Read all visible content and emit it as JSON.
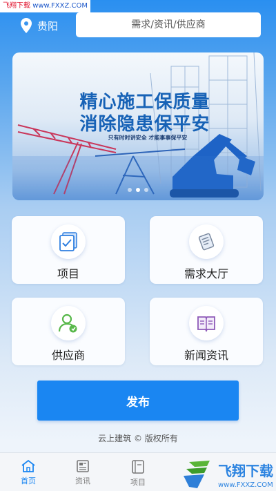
{
  "watermark": {
    "text": "飞翔下载",
    "url": "www.FXXZ.COM"
  },
  "header": {
    "city": "贵阳",
    "search_placeholder": "需求/资讯/供应商"
  },
  "banner": {
    "title_line1": "精心施工保质量",
    "title_line2": "消除隐患保平安",
    "subtitle": "只有时时讲安全 才能事事保平安",
    "dots": 3,
    "active_dot": 2
  },
  "grid": [
    {
      "label": "项目",
      "icon": "project-icon"
    },
    {
      "label": "需求大厅",
      "icon": "demand-hall-icon"
    },
    {
      "label": "供应商",
      "icon": "supplier-icon"
    },
    {
      "label": "新闻资讯",
      "icon": "news-icon"
    }
  ],
  "publish_label": "发布",
  "copyright": "云上建筑 © 版权所有",
  "tabs": [
    {
      "label": "首页",
      "icon": "home-icon",
      "active": true
    },
    {
      "label": "资讯",
      "icon": "news-tab-icon",
      "active": false
    },
    {
      "label": "项目",
      "icon": "project-tab-icon",
      "active": false
    }
  ],
  "overlay_logo": {
    "text": "飞翔下载",
    "url": "www.FXXZ.COM"
  },
  "colors": {
    "primary": "#1a86f2",
    "banner_title": "#1762b6",
    "icon_blue": "#2f7fe0",
    "icon_green": "#58b84a",
    "icon_purple": "#8e59b8"
  }
}
